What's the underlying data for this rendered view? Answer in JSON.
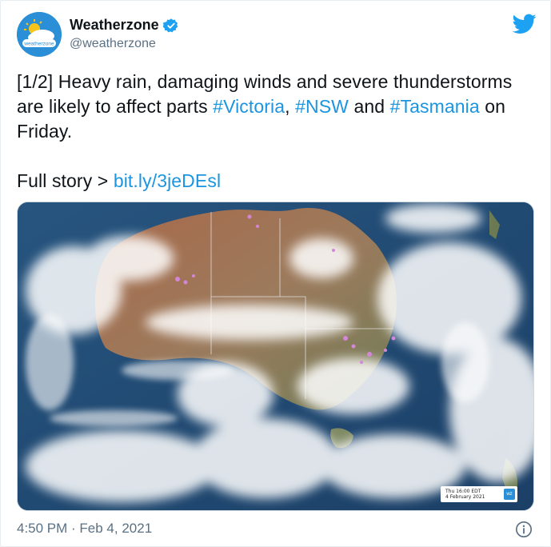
{
  "account": {
    "display_name": "Weatherzone",
    "handle": "@weatherzone",
    "avatar_logo_text": "weatherzone",
    "verified_icon": "verified-badge-icon",
    "platform_icon": "twitter-bird-icon"
  },
  "tweet": {
    "line1_prefix": "[1/2] Heavy rain, damaging winds and severe thunderstorms",
    "line2_prefix": "are likely to affect parts ",
    "hashtag_victoria": "#Victoria",
    "sep1": ", ",
    "hashtag_nsw": "#NSW",
    "and_word": " and ",
    "hashtag_tasmania": "#Tasmania",
    "line2_suffix": " on",
    "line3": "Friday.",
    "story_prefix": "Full story > ",
    "story_link": "bit.ly/3jeDEsl"
  },
  "media": {
    "type": "satellite-image",
    "timestamp_main": "Thu 16:00 EDT",
    "timestamp_sub": "4 February 2021",
    "stamp_logo": "wz"
  },
  "footer": {
    "timestamp": "4:50 PM · Feb 4, 2021",
    "info_icon": "info-icon"
  },
  "colors": {
    "link": "#1b95e0",
    "text": "#0f1419",
    "muted": "#5b7083",
    "brand": "#2a8fd6"
  }
}
